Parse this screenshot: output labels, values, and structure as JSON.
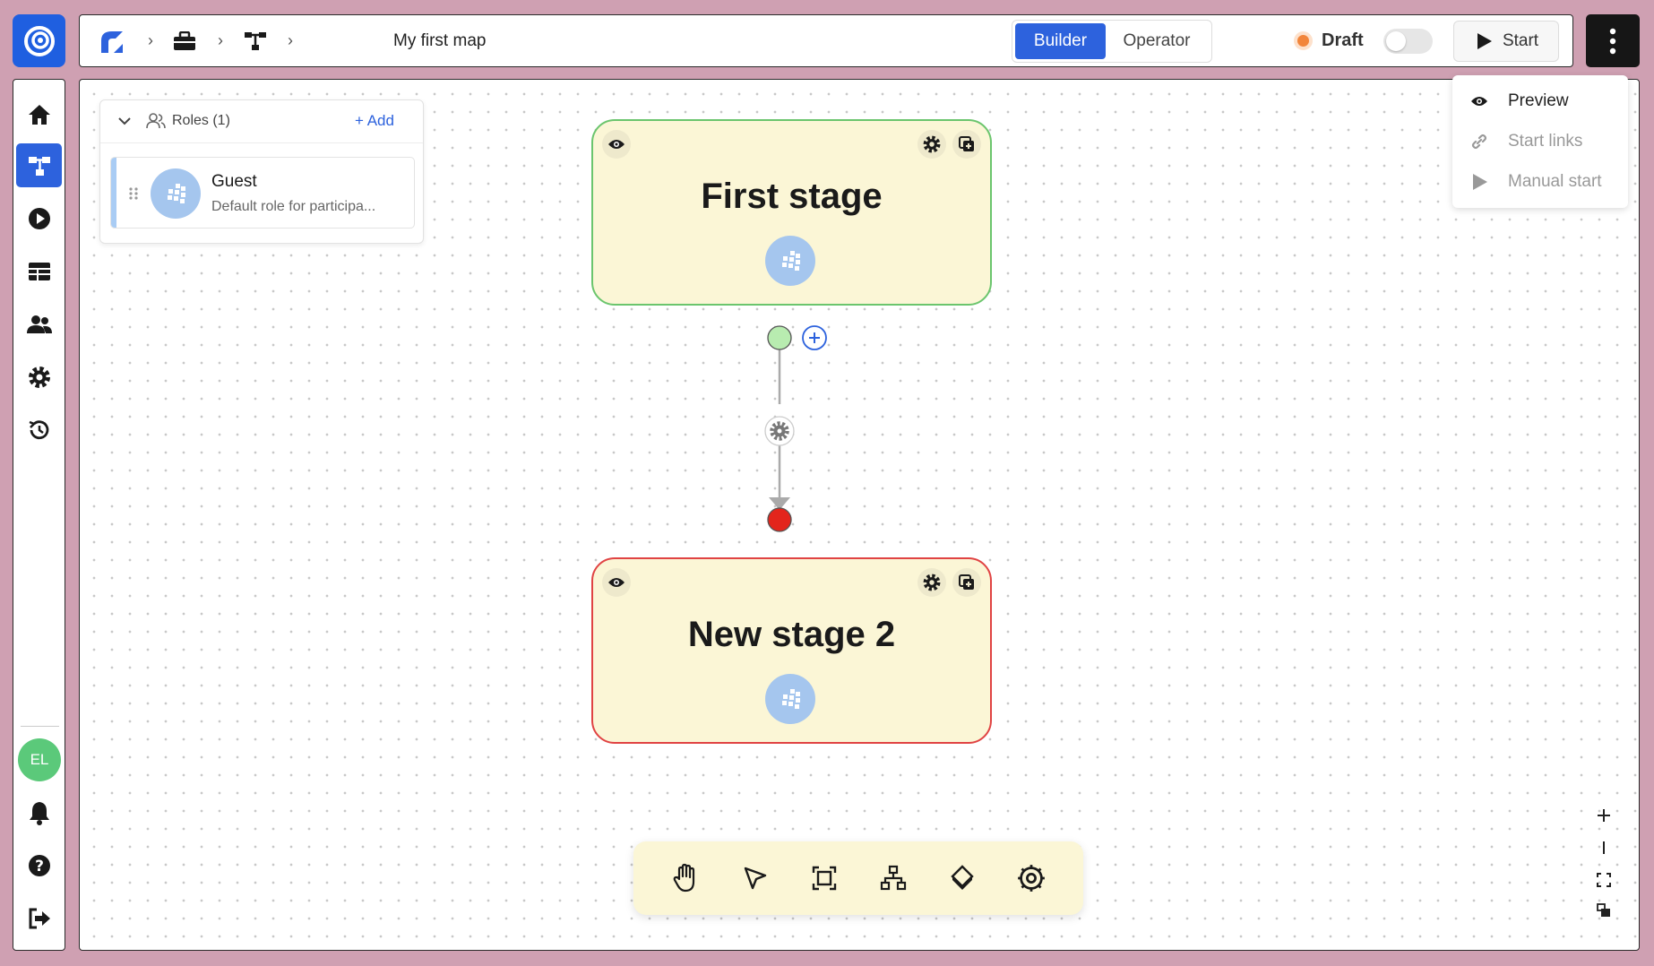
{
  "app": {
    "logo": "app-logo-icon"
  },
  "breadcrumb": {
    "items": [
      "workspace-logo-icon",
      "briefcase-icon",
      "map-tree-icon"
    ],
    "title": "My first map"
  },
  "mode_switch": {
    "active": "Builder",
    "inactive": "Operator"
  },
  "status": {
    "label": "Draft",
    "color": "#f2853b",
    "toggle_on": false
  },
  "start_button": {
    "label": "Start"
  },
  "dropdown": {
    "items": [
      {
        "label": "Preview",
        "icon": "eye-icon",
        "enabled": true
      },
      {
        "label": "Start links",
        "icon": "link-icon",
        "enabled": false
      },
      {
        "label": "Manual start",
        "icon": "play-icon",
        "enabled": false
      }
    ]
  },
  "sidebar": {
    "items": [
      "home-icon",
      "map-icon",
      "play-circle-icon",
      "table-icon",
      "users-icon",
      "settings-icon",
      "history-icon"
    ],
    "active": "map-icon",
    "avatar": "EL",
    "bottom": [
      "bell-icon",
      "help-icon",
      "logout-icon"
    ]
  },
  "roles_panel": {
    "title": "Roles (1)",
    "add_label": "+ Add",
    "roles": [
      {
        "name": "Guest",
        "description": "Default role for participa..."
      }
    ]
  },
  "stages": [
    {
      "title": "First stage",
      "status_color": "#6bc56d"
    },
    {
      "title": "New stage 2",
      "status_color": "#e04343"
    }
  ],
  "connector": {
    "start_color": "#b8ecb0",
    "end_color": "#e3251c"
  },
  "toolbar": {
    "tools": [
      "hand-icon",
      "pointer-icon",
      "frame-icon",
      "hierarchy-icon",
      "decision-icon",
      "settings-icon"
    ]
  },
  "zoom_controls": [
    "zoom-in-icon",
    "zoom-out-icon",
    "fit-screen-icon",
    "minimap-icon"
  ],
  "colors": {
    "accent": "#2d62dd",
    "stage_bg": "#fbf6d6",
    "role_avatar": "#a5c6ee"
  }
}
